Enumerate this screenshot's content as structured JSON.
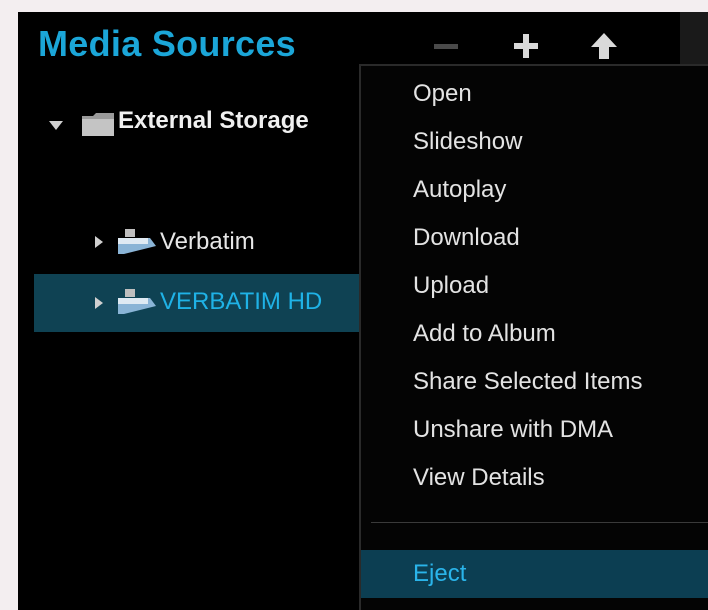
{
  "header": {
    "title": "Media Sources"
  },
  "toolbar": {
    "buttons": [
      {
        "name": "remove",
        "icon": "minus-icon"
      },
      {
        "name": "add",
        "icon": "plus-icon"
      },
      {
        "name": "up",
        "icon": "up-arrow-icon"
      }
    ]
  },
  "tree": {
    "items": [
      {
        "label": "External Storage",
        "icon": "folder-icon",
        "expanded": true
      },
      {
        "label": "Verbatim",
        "icon": "usb-drive-icon",
        "expanded": false
      },
      {
        "label": "VERBATIM HD",
        "icon": "usb-drive-icon",
        "expanded": false,
        "selected": true
      }
    ]
  },
  "context_menu": {
    "items": [
      {
        "label": "Open"
      },
      {
        "label": "Slideshow"
      },
      {
        "label": "Autoplay"
      },
      {
        "label": "Download"
      },
      {
        "label": "Upload"
      },
      {
        "label": "Add to Album"
      },
      {
        "label": "Share Selected Items"
      },
      {
        "label": "Unshare with DMA"
      },
      {
        "label": "View Details"
      },
      {
        "label": "Eject",
        "highlighted": true
      }
    ]
  },
  "colors": {
    "accent": "#1ba6d8",
    "selection_bg": "#0f4253",
    "menu_bg": "#040404",
    "text": "#e3e3e3"
  }
}
